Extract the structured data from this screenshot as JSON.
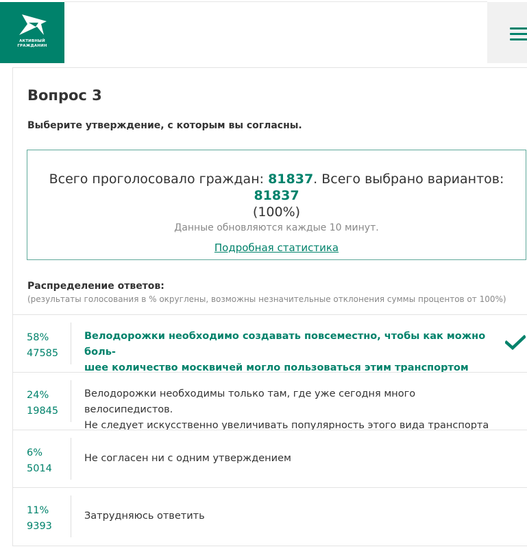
{
  "header": {
    "logo_text_line1": "АКТИВНЫЙ",
    "logo_text_line2": "ГРАЖДАНИН",
    "menu_icon": "hamburger-menu-icon"
  },
  "question": {
    "title": "Вопрос 3",
    "text": "Выберите утверждение, с которым вы согласны."
  },
  "stats": {
    "voted_label": "Всего проголосовало граждан: ",
    "voted_value": "81837",
    "options_label": ". Всего выбрано вариантов: ",
    "options_value": "81837",
    "percent": "(100%)",
    "update_note": "Данные обновляются каждые 10 минут.",
    "details_link": "Подробная статистика"
  },
  "distribution": {
    "title": "Распределение ответов:",
    "note": "(результаты голосования в % округлены, возможны незначительные отклонения суммы процентов от 100%)"
  },
  "answers": [
    {
      "percent": "58%",
      "count": "47585",
      "line1": "Велодорожки необходимо создавать повсеместно, чтобы как можно боль-",
      "line2": "шее количество москвичей могло пользоваться этим транспортом",
      "selected": true
    },
    {
      "percent": "24%",
      "count": "19845",
      "line1": "Велодорожки необходимы только там, где уже сегодня много велосипедистов.",
      "line2": "Не следует искусственно увеличивать популярность этого вида транспорта",
      "selected": false
    },
    {
      "percent": "6%",
      "count": "5014",
      "line1": "Не согласен ни с одним утверждением",
      "selected": false
    },
    {
      "percent": "11%",
      "count": "9393",
      "line1": "Затрудняюсь ответить",
      "selected": false
    }
  ],
  "colors": {
    "brand_green": "#00826b",
    "text": "#333333",
    "muted": "#888888"
  }
}
